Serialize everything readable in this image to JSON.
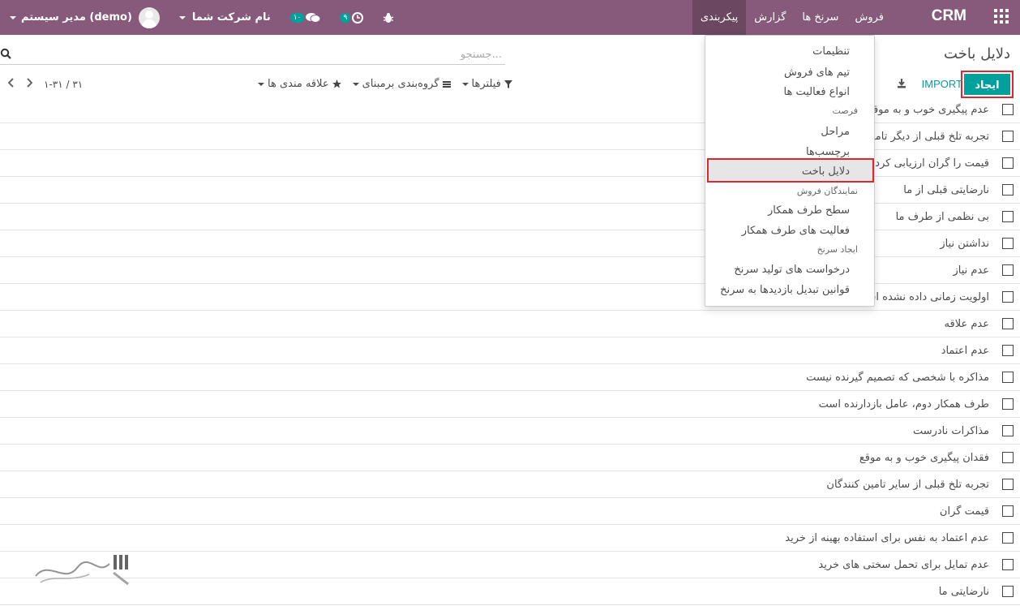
{
  "navbar": {
    "brand": "CRM",
    "menu": [
      {
        "label": "فروش"
      },
      {
        "label": "سرنخ ها"
      },
      {
        "label": "گزارش"
      },
      {
        "label": "پیکربندی"
      }
    ],
    "user_name": "مدیر سیستم (demo)",
    "company_label": "نام شرکت شما",
    "activity_count": "۹",
    "message_count": "۱۰",
    "bg_color": "#875a7b"
  },
  "control": {
    "page_title": "دلایل باخت",
    "search_placeholder": "جستجو...",
    "create_label": "ایجاد",
    "import_label": "IMPORT",
    "filters_label": "فیلترها",
    "groupby_label": "گروه‌بندی برمبنای",
    "favorites_label": "علاقه مندی ها",
    "pager_text": "۱-۳۱ / ۳۱",
    "accent": "#00a09d"
  },
  "dropdown": {
    "items": [
      {
        "label": "تنظیمات",
        "type": "item"
      },
      {
        "label": "تیم های فروش",
        "type": "item"
      },
      {
        "label": "انواع فعالیت ها",
        "type": "item"
      },
      {
        "label": "فرصت",
        "type": "header"
      },
      {
        "label": "مراحل",
        "type": "item"
      },
      {
        "label": "برچسب‌ها",
        "type": "item"
      },
      {
        "label": "دلایل باخت",
        "type": "item"
      },
      {
        "label": "نمایندگان فروش",
        "type": "header"
      },
      {
        "label": "سطح طرف همکار",
        "type": "item"
      },
      {
        "label": "فعالیت های طرف همکار",
        "type": "item"
      },
      {
        "label": "ایجاد سرنخ",
        "type": "header"
      },
      {
        "label": "درخواست های تولید سرنخ",
        "type": "item"
      },
      {
        "label": "قوانین تبدیل بازدیدها به سرنخ",
        "type": "item"
      }
    ]
  },
  "table": {
    "rows": [
      "عدم پیگیری خوب و به موقع",
      "تجربه تلخ قبلی از دیگر تامین کنندگان",
      "قیمت را گران ارزیابی کردن",
      "نارضایتی قبلی از ما",
      "بی نظمی از طرف ما",
      "نداشتن نیاز",
      "عدم نیاز",
      "اولویت زمانی داده نشده است",
      "عدم علاقه",
      "عدم اعتماد",
      "مذاکره با شخصی که تصمیم گیرنده نیست",
      "طرف همکار دوم، عامل بازدارنده است",
      "مذاکرات نادرست",
      "فقدان پیگیری خوب و به موقع",
      "تجربه تلخ قبلی از سایر تامین کنندگان",
      "قیمت گران",
      "عدم اعتماد به نفس برای استفاده بهینه از خرید",
      "عدم تمایل برای تحمل سختی های خرید",
      "نارضایتی ما"
    ]
  }
}
